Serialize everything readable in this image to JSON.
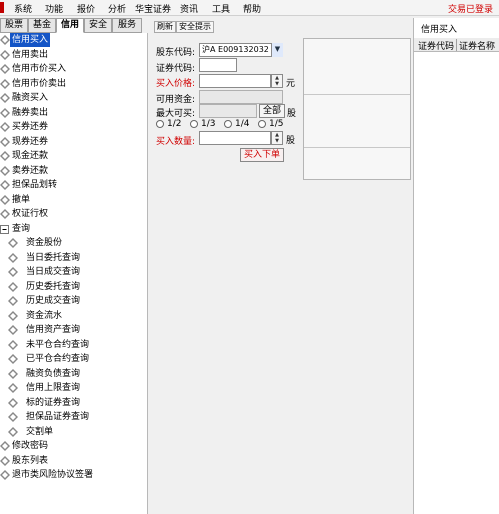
{
  "menubar": {
    "items": [
      "系统",
      "功能",
      "报价",
      "分析",
      "华宝证券",
      "资讯",
      "工具",
      "帮助"
    ],
    "login_status": "交易已登录"
  },
  "tabs": [
    "股票",
    "基金",
    "信用",
    "安全",
    "服务"
  ],
  "active_tab": "信用",
  "tree": {
    "items": [
      "信用买入",
      "信用卖出",
      "信用市价买入",
      "信用市价卖出",
      "融资买入",
      "融券卖出",
      "买券还券",
      "现券还券",
      "现金还款",
      "卖券还款",
      "担保品划转",
      "撤单",
      "权证行权"
    ],
    "query_group": "查询",
    "query_items": [
      "资金股份",
      "当日委托查询",
      "当日成交查询",
      "历史委托查询",
      "历史成交查询",
      "资金流水",
      "信用资产查询",
      "未平仓合约查询",
      "已平仓合约查询",
      "融资负债查询",
      "信用上限查询",
      "标的证券查询",
      "担保品证券查询",
      "交割单"
    ],
    "bottom_items": [
      "修改密码",
      "股东列表",
      "退市类风险协议签署"
    ]
  },
  "toolbar": {
    "refresh": "刷新",
    "safety_tip": "安全提示"
  },
  "form": {
    "account_label": "股东代码:",
    "account_value": "沪A E009132032",
    "code_label": "证券代码:",
    "code_value": "",
    "price_label": "买入价格:",
    "price_value": "",
    "price_unit": "元",
    "available_label": "可用资金:",
    "available_value": "",
    "max_label": "最大可买:",
    "max_value": "",
    "all_button": "全部",
    "max_unit": "股",
    "fractions": [
      "1/2",
      "1/3",
      "1/4",
      "1/5"
    ],
    "qty_label": "买入数量:",
    "qty_value": "",
    "qty_unit": "股",
    "submit": "买入下单"
  },
  "right_panel": {
    "title": "信用买入",
    "columns": [
      "证券代码",
      "证券名称"
    ]
  },
  "colors": {
    "accent_red": "#d00000",
    "selection_blue": "#1455c6"
  }
}
